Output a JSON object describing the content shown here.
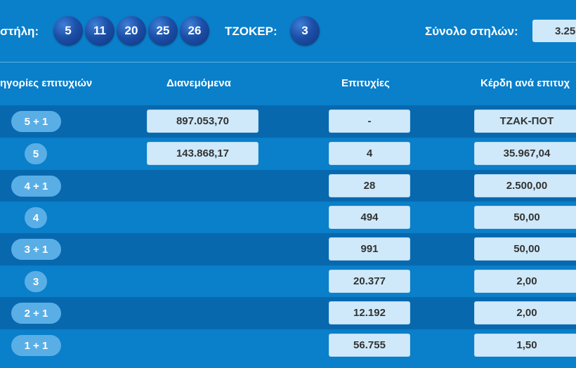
{
  "header": {
    "column_label": "στήλη:",
    "numbers": [
      "5",
      "11",
      "20",
      "25",
      "26"
    ],
    "joker_label": "ΤΖΟΚΕΡ:",
    "joker_number": "3",
    "total_label": "Σύνολο στηλών:",
    "total_value": "3.25"
  },
  "table": {
    "headers": {
      "categories": "ηγορίες επιτυχιών",
      "distributed": "Διανεμόμενα",
      "winners": "Επιτυχίες",
      "prize": "Κέρδη ανά επιτυχ"
    },
    "rows": [
      {
        "category": "5 + 1",
        "distributed": "897.053,70",
        "winners": "-",
        "prize": "ΤΖΑΚ-ΠΟΤ"
      },
      {
        "category": "5",
        "distributed": "143.868,17",
        "winners": "4",
        "prize": "35.967,04"
      },
      {
        "category": "4 + 1",
        "distributed": "",
        "winners": "28",
        "prize": "2.500,00"
      },
      {
        "category": "4",
        "distributed": "",
        "winners": "494",
        "prize": "50,00"
      },
      {
        "category": "3 + 1",
        "distributed": "",
        "winners": "991",
        "prize": "50,00"
      },
      {
        "category": "3",
        "distributed": "",
        "winners": "20.377",
        "prize": "2,00"
      },
      {
        "category": "2 + 1",
        "distributed": "",
        "winners": "12.192",
        "prize": "2,00"
      },
      {
        "category": "1 + 1",
        "distributed": "",
        "winners": "56.755",
        "prize": "1,50"
      }
    ]
  },
  "colors": {
    "background": "#0a7fca",
    "row_dark": "#0868ae",
    "ball": "#1c4fa8",
    "pill": "#5aaee6",
    "cell": "#cfe9fa"
  }
}
